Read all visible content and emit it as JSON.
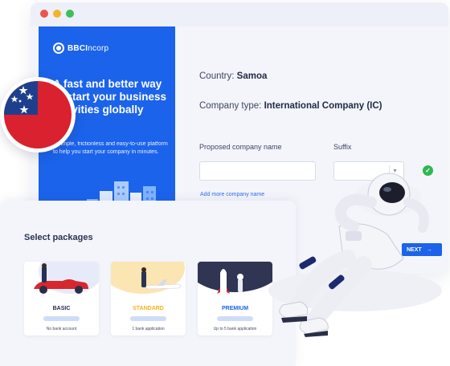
{
  "brand": {
    "logo_bold": "BBCI",
    "logo_rest": "ncorp"
  },
  "hero": {
    "headline": "A fast and better way to start your business activities globally",
    "subline": "A simple, frictionless and easy-to-use platform to help you start your company in minutes."
  },
  "form": {
    "country_label": "Country:",
    "country_value": "Samoa",
    "company_type_label": "Company type:",
    "company_type_value": "International Company (IC)",
    "proposed_name_label": "Proposed company name",
    "proposed_name_value": "",
    "suffix_label": "Suffix",
    "suffix_value": "",
    "add_more": "Add more company name",
    "next_label": "NEXT",
    "next_arrow": "→"
  },
  "packages": {
    "title": "Select packages",
    "items": [
      {
        "name": "BASIC",
        "feature": "No bank account",
        "color": "#1f2a4d"
      },
      {
        "name": "STANDARD",
        "feature": "1 bank application",
        "color": "#f2b21b"
      },
      {
        "name": "PREMIUM",
        "feature": "Up to 5 bank application",
        "color": "#1b63ea"
      }
    ]
  },
  "colors": {
    "primary": "#1b63ea",
    "success": "#2eb84f",
    "flag_red": "#d9212f",
    "flag_blue": "#1f3f8e"
  },
  "icons": {
    "check": "check-circle-icon",
    "dropdown": "chevron-down-icon",
    "arrow": "arrow-right-icon"
  }
}
